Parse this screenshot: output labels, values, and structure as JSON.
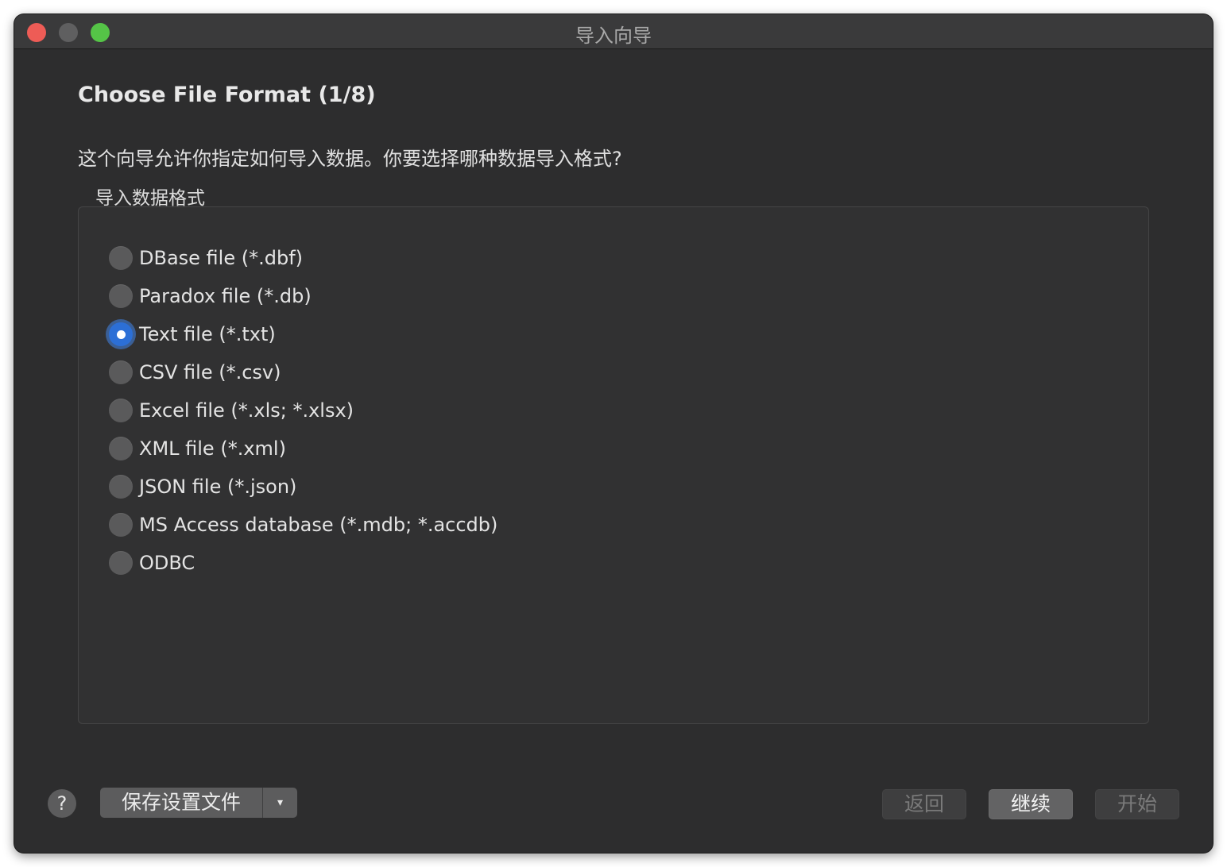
{
  "window": {
    "title": "导入向导"
  },
  "page": {
    "heading": "Choose File Format (1/8)",
    "description": "这个向导允许你指定如何导入数据。你要选择哪种数据导入格式?"
  },
  "format_group": {
    "label": "导入数据格式",
    "selected": "Text file (*.txt)",
    "options": [
      "DBase file (*.dbf)",
      "Paradox file (*.db)",
      "Text file (*.txt)",
      "CSV file (*.csv)",
      "Excel file (*.xls; *.xlsx)",
      "XML file (*.xml)",
      "JSON file (*.json)",
      "MS Access database (*.mdb; *.accdb)",
      "ODBC"
    ]
  },
  "footer": {
    "help_label": "?",
    "save_settings_label": "保存设置文件",
    "dropdown_arrow": "▾",
    "back_label": "返回",
    "continue_label": "继续",
    "start_label": "开始"
  },
  "colors": {
    "window_bg": "#2d2d2e",
    "accent": "#2c6fd6",
    "close": "#ee5c56",
    "maximize": "#55c447"
  }
}
